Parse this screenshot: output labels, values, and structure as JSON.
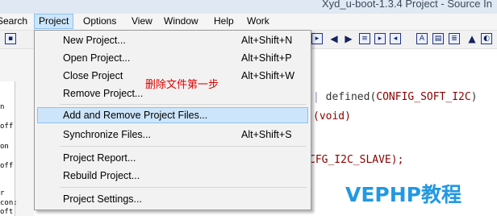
{
  "window": {
    "title": "Xyd_u-boot-1.3.4 Project - Source In"
  },
  "menubar": {
    "items": [
      {
        "label": "Search"
      },
      {
        "label": "Project"
      },
      {
        "label": "Options"
      },
      {
        "label": "View"
      },
      {
        "label": "Window"
      },
      {
        "label": "Help"
      },
      {
        "label": "Work"
      }
    ],
    "active": "Project"
  },
  "project_menu": {
    "items": [
      {
        "label": "New Project...",
        "shortcut": "Alt+Shift+N"
      },
      {
        "label": "Open Project...",
        "shortcut": "Alt+Shift+P"
      },
      {
        "label": "Close Project",
        "shortcut": "Alt+Shift+W"
      },
      {
        "label": "Remove Project...",
        "shortcut": ""
      },
      {
        "label": "Add and Remove Project Files...",
        "shortcut": "",
        "highlighted": true
      },
      {
        "label": "Synchronize Files...",
        "shortcut": "Alt+Shift+S"
      },
      {
        "label": "Project Report...",
        "shortcut": ""
      },
      {
        "label": "Rebuild Project...",
        "shortcut": ""
      },
      {
        "label": "Project Settings...",
        "shortcut": ""
      }
    ]
  },
  "annotation": {
    "text": "删除文件第一步",
    "color": "#e00000"
  },
  "editor": {
    "lines": [
      {
        "text": "| defined(CONFIG_SOFT_I2C)"
      },
      {
        "text": "(void)"
      },
      {
        "text": "CFG_I2C_SLAVE);"
      }
    ]
  },
  "left_panel": {
    "lines": [
      "n",
      "off",
      "on",
      "off",
      "r",
      "con:",
      "oft"
    ]
  },
  "watermark": {
    "text": "VEPHP教程",
    "color": "#2398e2"
  },
  "colors": {
    "menu_highlight": "#cde5fb",
    "menu_highlight_border": "#8cc1ee",
    "code_text": "#8b0000",
    "titlebar": "#dfe8f3"
  },
  "toolbar": {
    "icons": [
      "save-icon",
      "bookmark-toggle-icon",
      "arrow-left-icon",
      "arrow-right-icon",
      "bookmark-icon",
      "bookmark-next-icon",
      "bookmark-prev-icon",
      "lookup-icon",
      "browse-icon",
      "symbol-icon",
      "settings-icon"
    ]
  }
}
